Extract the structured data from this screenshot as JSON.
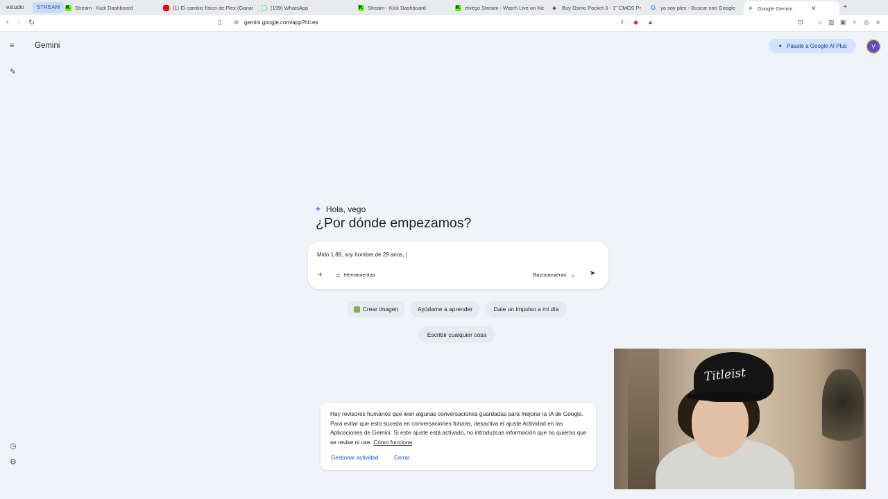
{
  "browser": {
    "tab_groups": [
      "estudio",
      "STREAM"
    ],
    "tabs": [
      {
        "label": "Stream - Kick Dashboard",
        "favicon": "kick-icon"
      },
      {
        "label": "(1) El cambio físico de Plex (Ganar",
        "favicon": "youtube-icon"
      },
      {
        "label": "(199) WhatsApp",
        "favicon": "whatsapp-icon"
      },
      {
        "label": "Stream - Kick Dashboard",
        "favicon": "kick-icon"
      },
      {
        "label": "elvego Stream - Watch Live on Kic",
        "favicon": "kick-icon"
      },
      {
        "label": "Buy Osmo Pocket 3 - 1\" CMOS Pr",
        "favicon": "dji-icon"
      },
      {
        "label": "ya soy plex - Buscar con Google",
        "favicon": "google-icon"
      },
      {
        "label": "Google Gemini",
        "favicon": "gemini-icon",
        "active": true
      }
    ],
    "close_glyph": "✕",
    "new_tab_glyph": "+",
    "url": "gemini.google.com/app?hl=es"
  },
  "app": {
    "brand": "Gemini",
    "upgrade_label": "Pásate a Google AI Plus",
    "avatar_initial": "V"
  },
  "greeting": {
    "hello": "Hola, vego",
    "question": "¿Por dónde empezamos?"
  },
  "prompt": {
    "value": "Mido 1.89, soy hombre de 29 anos, |",
    "tools_label": "Herramientas",
    "mode_label": "Razonamiento"
  },
  "chips": [
    {
      "label": "Crear imagen"
    },
    {
      "label": "Ayúdame a aprender"
    },
    {
      "label": "Dale un impulso a mi día"
    },
    {
      "label": "Escribir cualquier cosa"
    }
  ],
  "notice": {
    "text": "Hay revisores humanos que leen algunas conversaciones guardadas para mejorar la IA de Google. Para evitar que esto suceda en conversaciones futuras, desactiva el ajuste Actividad en las Aplicaciones de Gemini. Si este ajuste está activado, no introduzcas información que no quieras que se revise ni use.",
    "link": "Cómo funciona",
    "manage_label": "Gestionar actividad",
    "close_label": "Cerrar"
  },
  "webcam": {
    "cap_logo": "Titleist"
  }
}
